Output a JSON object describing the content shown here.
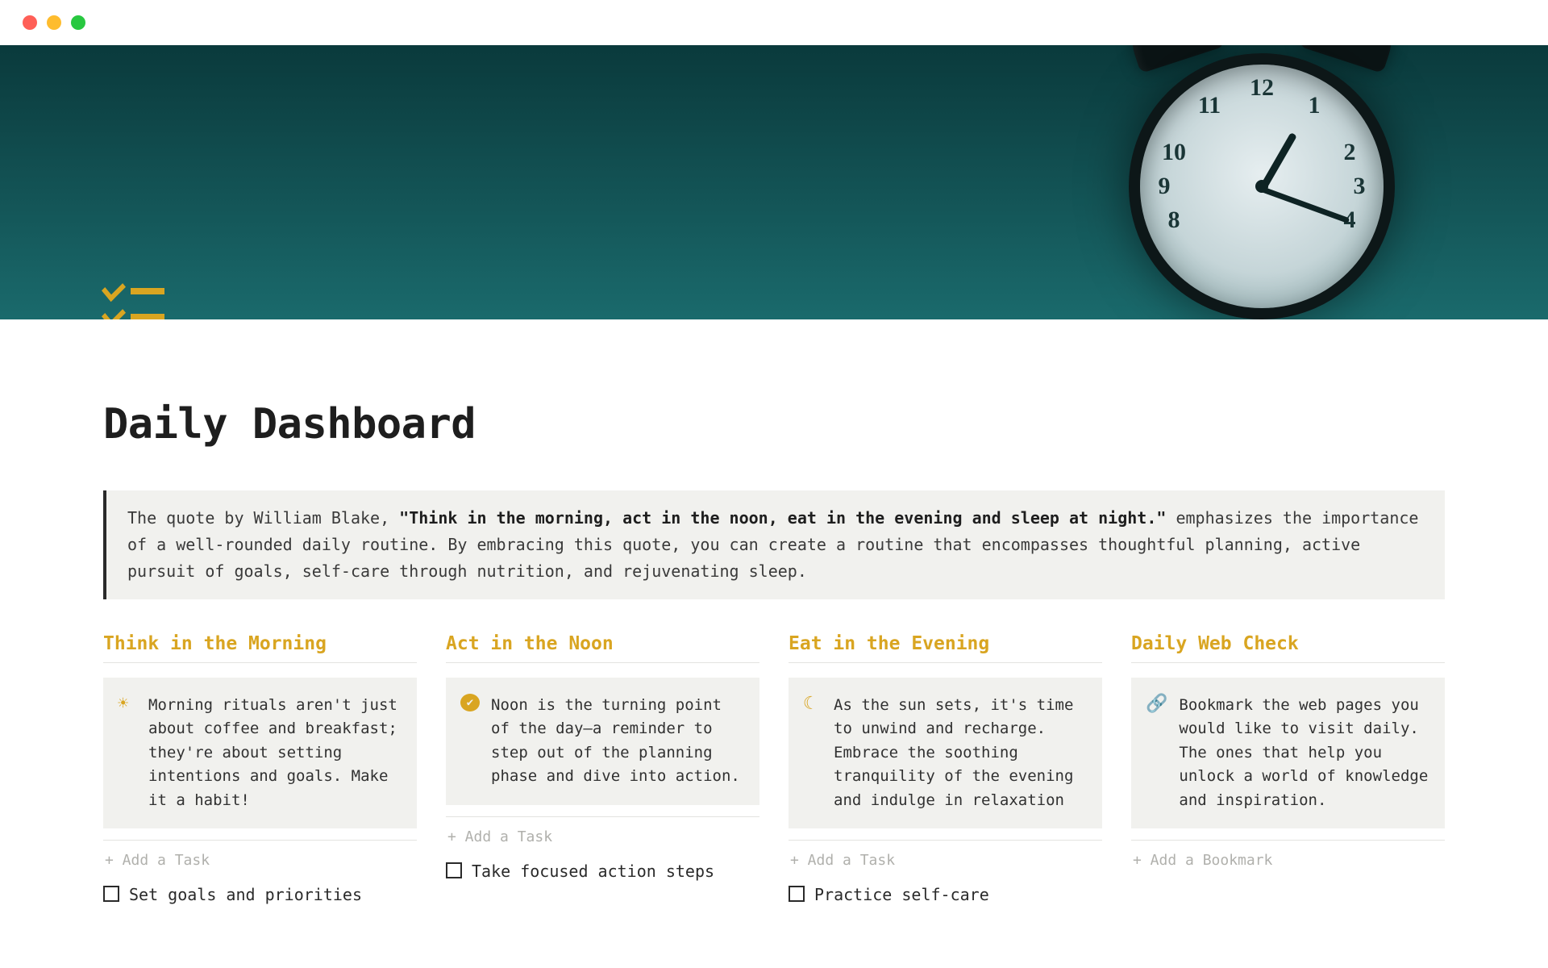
{
  "page": {
    "title": "Daily Dashboard"
  },
  "quote": {
    "prefix": "The quote by William Blake, ",
    "bold": "\"Think in the morning, act in the noon, eat in the evening and sleep at night.\"",
    "suffix": " emphasizes the importance of a well-rounded daily routine. By embracing this quote, you can create a routine that encompasses thoughtful planning, active pursuit of goals, self-care through nutrition, and rejuvenating sleep."
  },
  "columns": [
    {
      "heading": "Think in the Morning",
      "icon": "sun-icon",
      "glyph": "☀",
      "callout": "Morning rituals aren't just about coffee and breakfast; they're about setting intentions and goals. Make it a habit!",
      "add_label": "+ Add a Task",
      "task": "Set goals and priorities"
    },
    {
      "heading": "Act in the Noon",
      "icon": "check-circle-icon",
      "glyph": "✔",
      "callout": "Noon is the turning point of the day—a reminder to step out of the planning phase and dive into action.",
      "add_label": "+ Add a Task",
      "task": "Take focused action steps"
    },
    {
      "heading": "Eat in the Evening",
      "icon": "moon-icon",
      "glyph": "☾",
      "callout": "As the sun sets, it's time to unwind and recharge. Embrace the soothing tranquility of the evening and indulge in relaxation",
      "add_label": "+ Add a Task",
      "task": "Practice self-care"
    },
    {
      "heading": "Daily Web Check",
      "icon": "link-icon",
      "glyph": "🔗",
      "callout": "Bookmark the web pages you would like to visit daily. The ones that help you unlock a world of knowledge and inspiration.",
      "add_label": "+ Add a Bookmark",
      "task": ""
    }
  ]
}
